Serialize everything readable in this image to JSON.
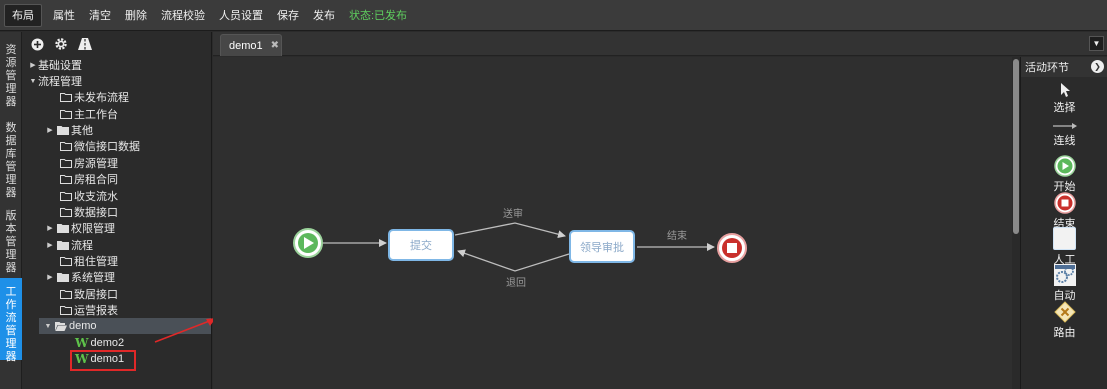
{
  "toolbar": {
    "buttons": [
      "布局",
      "属性",
      "清空",
      "删除",
      "流程校验",
      "人员设置",
      "保存",
      "发布"
    ],
    "status": "状态:已发布"
  },
  "vtabs": [
    "资源管理器",
    "数据库管理器",
    "版本管理器",
    "工作流管理器"
  ],
  "explorer": {
    "tree": [
      {
        "label": "基础设置",
        "kind": "section"
      },
      {
        "label": "流程管理",
        "kind": "section"
      },
      {
        "label": "未发布流程",
        "kind": "folder"
      },
      {
        "label": "主工作台",
        "kind": "folder"
      },
      {
        "label": "其他",
        "kind": "folder"
      },
      {
        "label": "微信接口数据",
        "kind": "folder"
      },
      {
        "label": "房源管理",
        "kind": "folder"
      },
      {
        "label": "房租合同",
        "kind": "folder"
      },
      {
        "label": "收支流水",
        "kind": "folder"
      },
      {
        "label": "数据接口",
        "kind": "folder"
      },
      {
        "label": "权限管理",
        "kind": "folder"
      },
      {
        "label": "流程",
        "kind": "folder"
      },
      {
        "label": "租住管理",
        "kind": "folder"
      },
      {
        "label": "系统管理",
        "kind": "folder"
      },
      {
        "label": "致居接口",
        "kind": "folder"
      },
      {
        "label": "运营报表",
        "kind": "folder"
      },
      {
        "label": "demo",
        "kind": "folder"
      },
      {
        "label": "demo2",
        "kind": "workflow"
      },
      {
        "label": "demo1",
        "kind": "workflow"
      }
    ]
  },
  "tabs": {
    "doc_tab": "demo1",
    "close_glyph": "✖"
  },
  "diagram": {
    "nodes": {
      "submit": "提交",
      "approve": "领导审批"
    },
    "edges": {
      "send": "送审",
      "back": "退回",
      "end": "结束"
    }
  },
  "palette": {
    "title": "活动环节",
    "items": [
      "选择",
      "连线",
      "开始",
      "结束",
      "人工",
      "自动",
      "路由"
    ]
  },
  "colors": {
    "accent": "#1e90e8",
    "status": "#5fcf5f",
    "start": "#5cb85c",
    "end": "#c9302c",
    "workflow_w": "#5ec24a",
    "highlight": "#e02828"
  }
}
